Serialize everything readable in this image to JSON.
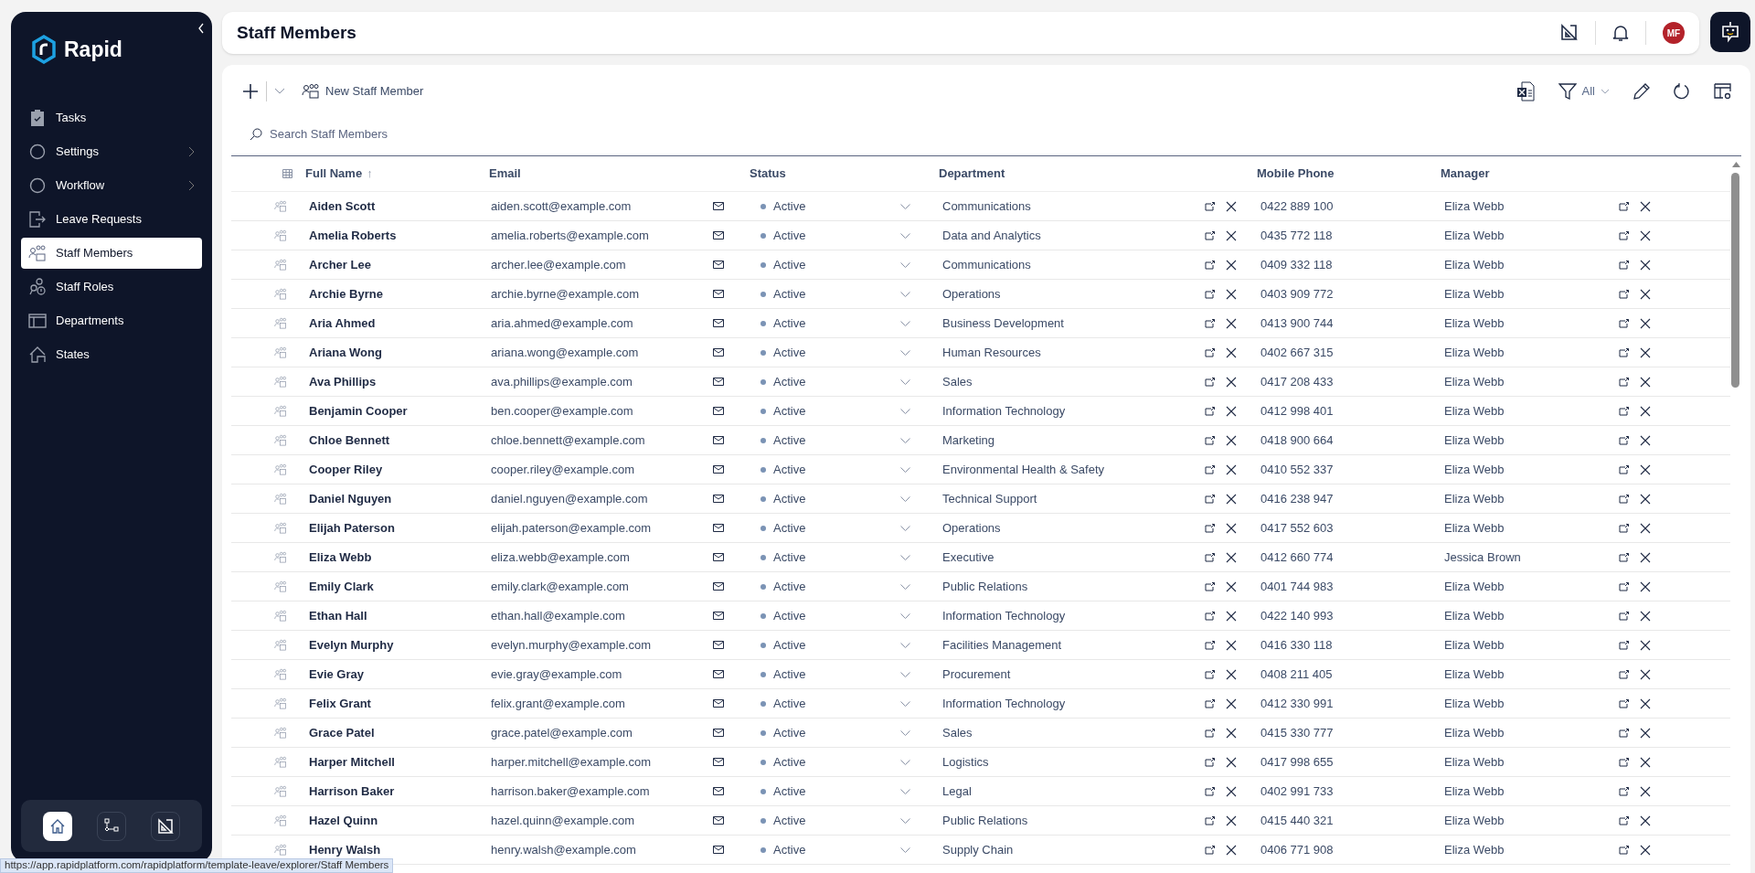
{
  "sidebar": {
    "brand": "Rapid",
    "items": [
      {
        "label": "Tasks",
        "selected": false,
        "has_submenu": false
      },
      {
        "label": "Settings",
        "selected": false,
        "has_submenu": true
      },
      {
        "label": "Workflow",
        "selected": false,
        "has_submenu": true
      },
      {
        "label": "Leave Requests",
        "selected": false,
        "has_submenu": false
      },
      {
        "label": "Staff Members",
        "selected": true,
        "has_submenu": false
      },
      {
        "label": "Staff Roles",
        "selected": false,
        "has_submenu": false
      },
      {
        "label": "Departments",
        "selected": false,
        "has_submenu": false
      },
      {
        "label": "States",
        "selected": false,
        "has_submenu": false
      }
    ],
    "dock": [
      {
        "selected": true
      },
      {
        "selected": false
      },
      {
        "selected": false
      }
    ]
  },
  "header": {
    "title": "Staff Members",
    "avatar": "MF"
  },
  "toolbar": {
    "new_button": "New Staff Member",
    "filter": "All",
    "search": {
      "placeholder": "Search Staff Members"
    }
  },
  "table": {
    "columns": [
      {
        "label": "Full Name",
        "sort_indicator": "↑"
      },
      {
        "label": "Email"
      },
      {
        "label": "Status"
      },
      {
        "label": "Department"
      },
      {
        "label": "Mobile Phone"
      },
      {
        "label": "Manager"
      }
    ],
    "rows": [
      {
        "name": "Aiden Scott",
        "email": "aiden.scott@example.com",
        "status": "Active",
        "department": "Communications",
        "phone": "0422 889 100",
        "manager": "Eliza Webb"
      },
      {
        "name": "Amelia Roberts",
        "email": "amelia.roberts@example.com",
        "status": "Active",
        "department": "Data and Analytics",
        "phone": "0435 772 118",
        "manager": "Eliza Webb"
      },
      {
        "name": "Archer Lee",
        "email": "archer.lee@example.com",
        "status": "Active",
        "department": "Communications",
        "phone": "0409 332 118",
        "manager": "Eliza Webb"
      },
      {
        "name": "Archie Byrne",
        "email": "archie.byrne@example.com",
        "status": "Active",
        "department": "Operations",
        "phone": "0403 909 772",
        "manager": "Eliza Webb"
      },
      {
        "name": "Aria Ahmed",
        "email": "aria.ahmed@example.com",
        "status": "Active",
        "department": "Business Development",
        "phone": "0413 900 744",
        "manager": "Eliza Webb"
      },
      {
        "name": "Ariana Wong",
        "email": "ariana.wong@example.com",
        "status": "Active",
        "department": "Human Resources",
        "phone": "0402 667 315",
        "manager": "Eliza Webb"
      },
      {
        "name": "Ava Phillips",
        "email": "ava.phillips@example.com",
        "status": "Active",
        "department": "Sales",
        "phone": "0417 208 433",
        "manager": "Eliza Webb"
      },
      {
        "name": "Benjamin Cooper",
        "email": "ben.cooper@example.com",
        "status": "Active",
        "department": "Information Technology",
        "phone": "0412 998 401",
        "manager": "Eliza Webb"
      },
      {
        "name": "Chloe Bennett",
        "email": "chloe.bennett@example.com",
        "status": "Active",
        "department": "Marketing",
        "phone": "0418 900 664",
        "manager": "Eliza Webb"
      },
      {
        "name": "Cooper Riley",
        "email": "cooper.riley@example.com",
        "status": "Active",
        "department": "Environmental Health & Safety",
        "phone": "0410 552 337",
        "manager": "Eliza Webb"
      },
      {
        "name": "Daniel Nguyen",
        "email": "daniel.nguyen@example.com",
        "status": "Active",
        "department": "Technical Support",
        "phone": "0416 238 947",
        "manager": "Eliza Webb"
      },
      {
        "name": "Elijah Paterson",
        "email": "elijah.paterson@example.com",
        "status": "Active",
        "department": "Operations",
        "phone": "0417 552 603",
        "manager": "Eliza Webb"
      },
      {
        "name": "Eliza Webb",
        "email": "eliza.webb@example.com",
        "status": "Active",
        "department": "Executive",
        "phone": "0412 660 774",
        "manager": "Jessica Brown"
      },
      {
        "name": "Emily Clark",
        "email": "emily.clark@example.com",
        "status": "Active",
        "department": "Public Relations",
        "phone": "0401 744 983",
        "manager": "Eliza Webb"
      },
      {
        "name": "Ethan Hall",
        "email": "ethan.hall@example.com",
        "status": "Active",
        "department": "Information Technology",
        "phone": "0422 140 993",
        "manager": "Eliza Webb"
      },
      {
        "name": "Evelyn Murphy",
        "email": "evelyn.murphy@example.com",
        "status": "Active",
        "department": "Facilities Management",
        "phone": "0416 330 118",
        "manager": "Eliza Webb"
      },
      {
        "name": "Evie Gray",
        "email": "evie.gray@example.com",
        "status": "Active",
        "department": "Procurement",
        "phone": "0408 211 405",
        "manager": "Eliza Webb"
      },
      {
        "name": "Felix Grant",
        "email": "felix.grant@example.com",
        "status": "Active",
        "department": "Information Technology",
        "phone": "0412 330 991",
        "manager": "Eliza Webb"
      },
      {
        "name": "Grace Patel",
        "email": "grace.patel@example.com",
        "status": "Active",
        "department": "Sales",
        "phone": "0415 330 777",
        "manager": "Eliza Webb"
      },
      {
        "name": "Harper Mitchell",
        "email": "harper.mitchell@example.com",
        "status": "Active",
        "department": "Logistics",
        "phone": "0417 998 655",
        "manager": "Eliza Webb"
      },
      {
        "name": "Harrison Baker",
        "email": "harrison.baker@example.com",
        "status": "Active",
        "department": "Legal",
        "phone": "0402 991 733",
        "manager": "Eliza Webb"
      },
      {
        "name": "Hazel Quinn",
        "email": "hazel.quinn@example.com",
        "status": "Active",
        "department": "Public Relations",
        "phone": "0415 440 321",
        "manager": "Eliza Webb"
      },
      {
        "name": "Henry Walsh",
        "email": "henry.walsh@example.com",
        "status": "Active",
        "department": "Supply Chain",
        "phone": "0406 771 908",
        "manager": "Eliza Webb"
      }
    ]
  },
  "status_bar": {
    "url": "https://app.rapidplatform.com/rapidplatform/template-leave/explorer/Staff Members"
  }
}
